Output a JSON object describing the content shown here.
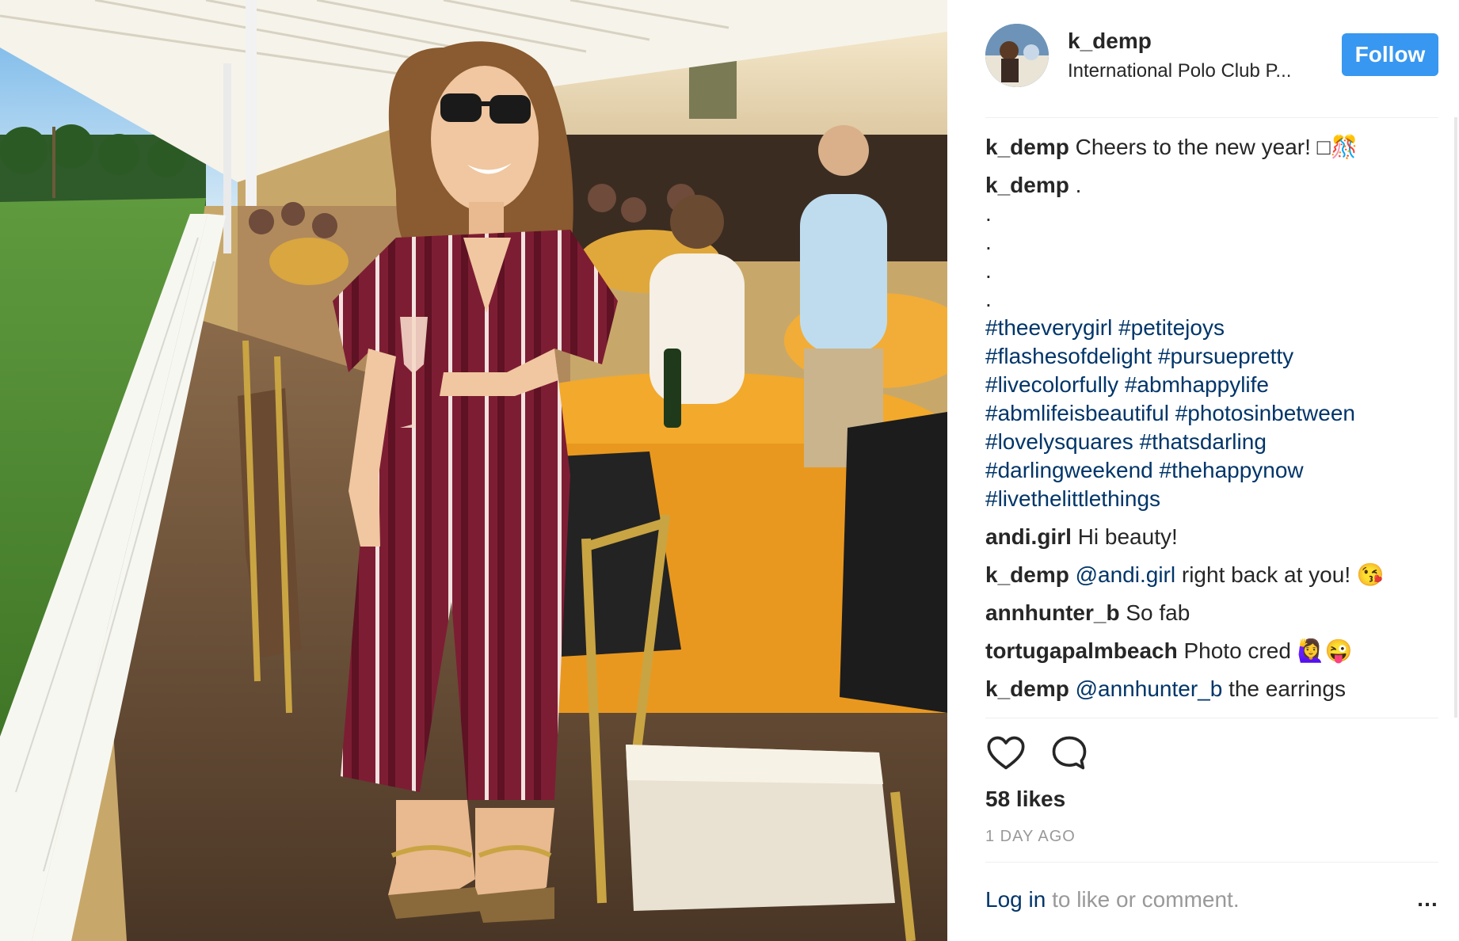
{
  "post": {
    "username": "k_demp",
    "location": "International Polo Club P...",
    "follow_label": "Follow"
  },
  "caption": {
    "user": "k_demp",
    "text": "Cheers to the new year! □🎊"
  },
  "second_comment": {
    "user": "k_demp",
    "text": "."
  },
  "dots": [
    ".",
    ".",
    ".",
    "."
  ],
  "hashtags": [
    [
      "#theeverygirl",
      "#petitejoys"
    ],
    [
      "#flashesofdelight",
      "#pursuepretty"
    ],
    [
      "#livecolorfully",
      "#abmhappylife"
    ],
    [
      "#abmlifeisbeautiful",
      "#photosinbetween"
    ],
    [
      "#lovelysquares",
      "#thatsdarling"
    ],
    [
      "#darlingweekend",
      "#thehappynow"
    ],
    [
      "#livethelittlethings"
    ]
  ],
  "comments": [
    {
      "user": "andi.girl",
      "mention": "",
      "text": "Hi beauty!"
    },
    {
      "user": "k_demp",
      "mention": "@andi.girl",
      "text": "right back at you! 😘"
    },
    {
      "user": "annhunter_b",
      "mention": "",
      "text": "So fab"
    },
    {
      "user": "tortugapalmbeach",
      "mention": "",
      "text": "Photo cred 🙋‍♀️😜"
    },
    {
      "user": "k_demp",
      "mention": "@annhunter_b",
      "text": "the earrings"
    }
  ],
  "likes": "58 likes",
  "time_ago": "1 DAY AGO",
  "footer": {
    "login_link": "Log in",
    "rest": " to like or comment.",
    "more": "…"
  },
  "icons": {
    "like": "heart-icon",
    "comment": "comment-bubble-icon",
    "more": "ellipsis-icon"
  },
  "colors": {
    "follow_button": "#3897f0",
    "hashtag": "#003569",
    "muted": "#999999",
    "text": "#262626"
  }
}
